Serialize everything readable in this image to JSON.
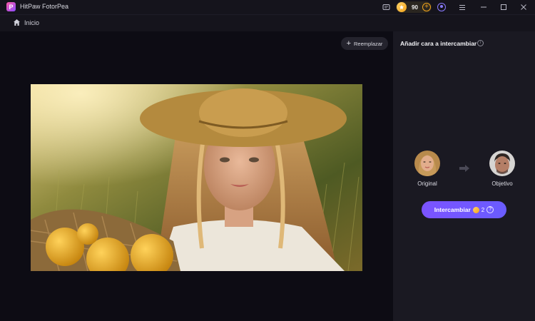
{
  "window": {
    "title": "HitPaw FotorPea",
    "logo_letter": "P",
    "credits": "90",
    "icons": [
      "message-icon",
      "coin-icon",
      "add-credits-icon",
      "account-icon",
      "menu-icon",
      "minimize-icon",
      "maximize-icon",
      "close-icon"
    ]
  },
  "nav": {
    "home_label": "Inicio"
  },
  "canvas": {
    "replace_label": "Reemplazar",
    "replace_icon": "plus"
  },
  "panel": {
    "title": "Añadir cara a intercambiar",
    "info_icon": "i",
    "original_label": "Original",
    "target_label": "Objetivo",
    "swap_label": "Intercambiar",
    "swap_cost": "2",
    "swap_help": "?"
  },
  "colors": {
    "accent": "#7357ff",
    "coin": "#f3a41b",
    "background": "#0d0c14",
    "panel": "#1a1922"
  }
}
